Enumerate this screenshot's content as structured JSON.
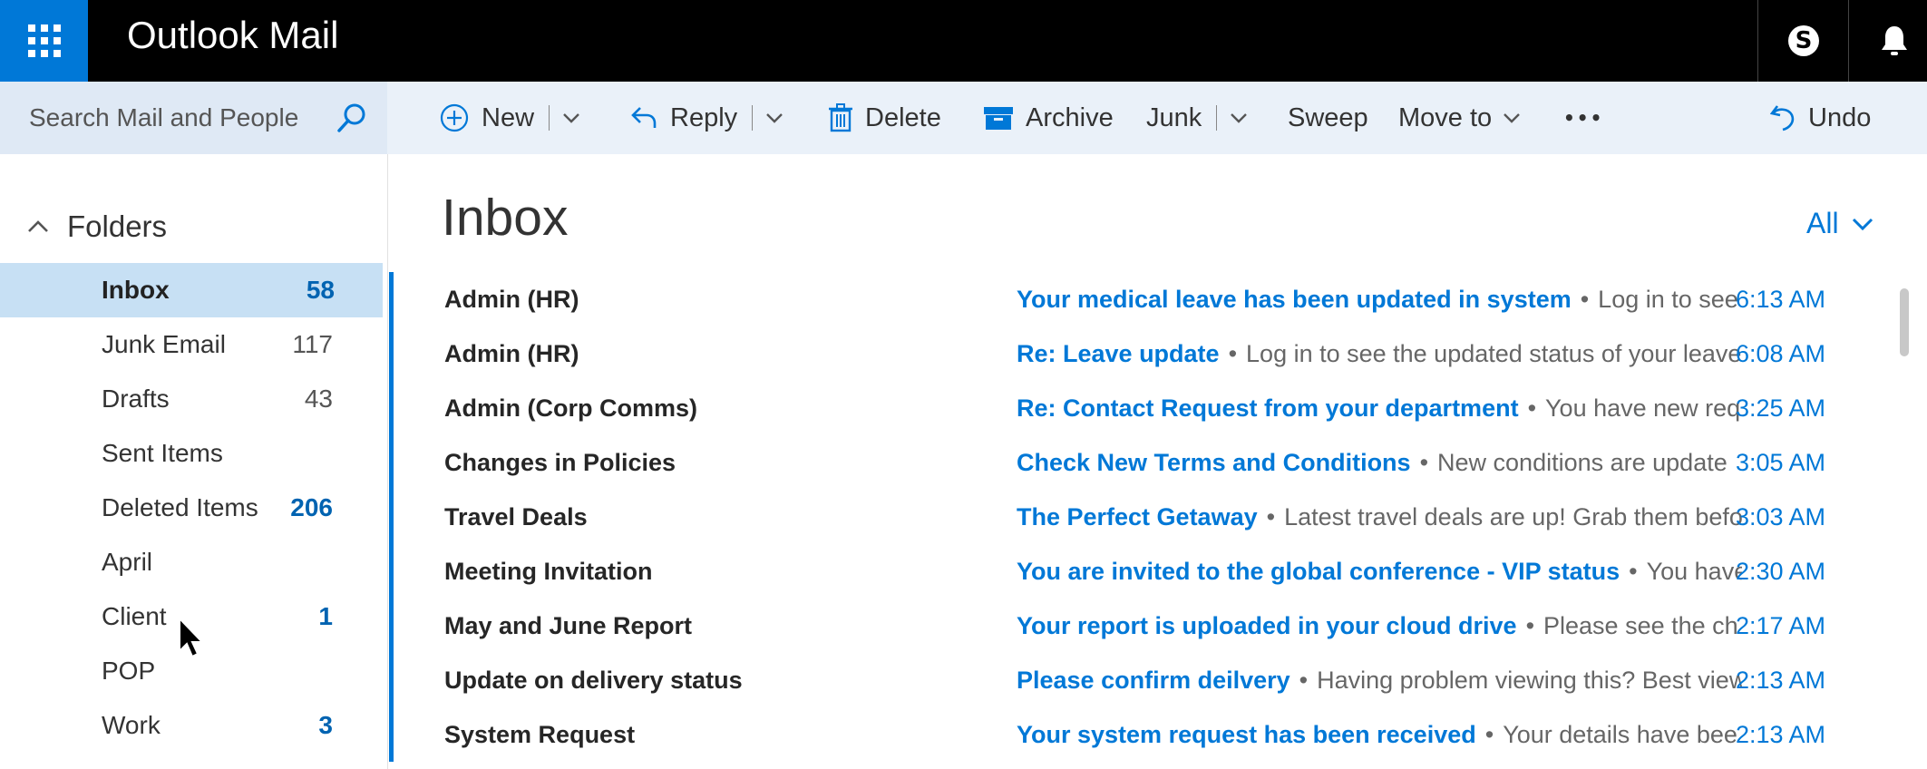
{
  "app": {
    "title": "Outlook Mail"
  },
  "icons": {
    "launcher": "app-launcher-icon",
    "skype": "skype-icon",
    "bell": "bell-icon",
    "search": "search-icon"
  },
  "search": {
    "placeholder": "Search Mail and People"
  },
  "toolbar": {
    "new_label": "New",
    "reply_label": "Reply",
    "delete_label": "Delete",
    "archive_label": "Archive",
    "junk_label": "Junk",
    "sweep_label": "Sweep",
    "move_label": "Move to",
    "more_label": "•••",
    "undo_label": "Undo"
  },
  "folders": {
    "heading": "Folders",
    "items": [
      {
        "name": "Inbox",
        "count": "58",
        "selected": true
      },
      {
        "name": "Junk Email",
        "count": "117"
      },
      {
        "name": "Drafts",
        "count": "43"
      },
      {
        "name": "Sent Items",
        "count": ""
      },
      {
        "name": "Deleted Items",
        "count": "206"
      },
      {
        "name": "April",
        "count": ""
      },
      {
        "name": "Client",
        "count": "1"
      },
      {
        "name": "POP",
        "count": ""
      },
      {
        "name": "Work",
        "count": "3"
      }
    ]
  },
  "inbox": {
    "title": "Inbox",
    "filter_label": "All"
  },
  "messages": [
    {
      "sender": "Admin (HR)",
      "subject": "Your medical leave has been updated in system",
      "preview": "Log in to see",
      "time": "6:13 AM"
    },
    {
      "sender": "Admin (HR)",
      "subject": "Re: Leave update",
      "preview": "Log in to see the updated status of your leave",
      "time": "6:08 AM"
    },
    {
      "sender": "Admin (Corp Comms)",
      "subject": "Re: Contact Request from your department",
      "preview": "You have new req",
      "time": "3:25 AM"
    },
    {
      "sender": "Changes in Policies",
      "subject": "Check New Terms and Conditions",
      "preview": "New conditions are update",
      "time": "3:05 AM"
    },
    {
      "sender": "Travel Deals",
      "subject": "The Perfect Getaway",
      "preview": "Latest travel deals are up! Grab them befo",
      "time": "3:03 AM"
    },
    {
      "sender": "Meeting Invitation",
      "subject": "You are invited to the global conference - VIP status",
      "preview": "You have",
      "time": "2:30 AM"
    },
    {
      "sender": "May and June Report",
      "subject": "Your report is uploaded in your cloud drive",
      "preview": "Please see the ch",
      "time": "2:17 AM"
    },
    {
      "sender": "Update on delivery status",
      "subject": "Please confirm deilvery",
      "preview": "Having problem viewing this? Best view",
      "time": "2:13 AM"
    },
    {
      "sender": "System Request",
      "subject": "Your system request has been received",
      "preview": "Your details have bee",
      "time": "2:13 AM"
    }
  ],
  "colors": {
    "accent": "#0078d7",
    "topbar": "#000000",
    "selected": "#c7e0f4"
  }
}
